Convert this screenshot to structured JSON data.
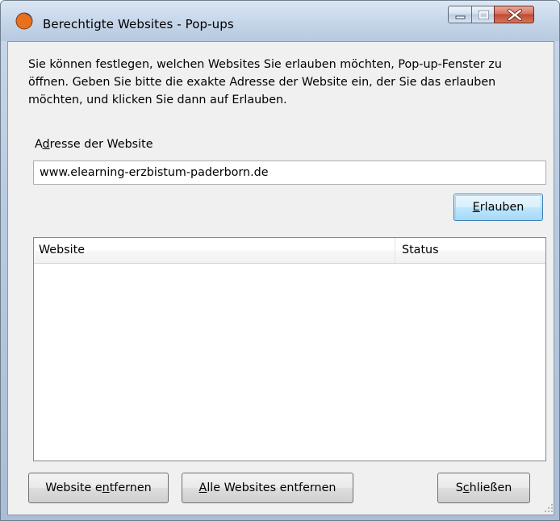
{
  "window": {
    "title": "Berechtigte Websites - Pop-ups",
    "app_icon": "firefox-icon",
    "caption_buttons": [
      "minimize-icon",
      "maximize-icon",
      "close-icon"
    ]
  },
  "dialog": {
    "description": "Sie können festlegen, welchen Websites Sie erlauben möchten, Pop-up-Fenster zu öffnen. Geben Sie bitte die exakte Adresse der Website ein, der Sie das erlauben möchten, und klicken Sie dann auf Erlauben.",
    "address_label_pre": "A",
    "address_label_accel": "d",
    "address_label_post": "resse der Website",
    "address_value": "www.elearning-erzbistum-paderborn.de",
    "allow_accel": "E",
    "allow_rest": "rlauben"
  },
  "list": {
    "columns": [
      "Website",
      "Status"
    ],
    "rows": []
  },
  "footer": {
    "remove_pre": "Website e",
    "remove_accel": "n",
    "remove_post": "tfernen",
    "remove_all_accel": "A",
    "remove_all_rest": "lle Websites entfernen",
    "close_pre": "S",
    "close_accel": "c",
    "close_post": "hließen"
  },
  "colors": {
    "accent_button_border": "#3c7fb1",
    "close_button": "#c24a32",
    "titlebar": "#c7d7ea"
  }
}
